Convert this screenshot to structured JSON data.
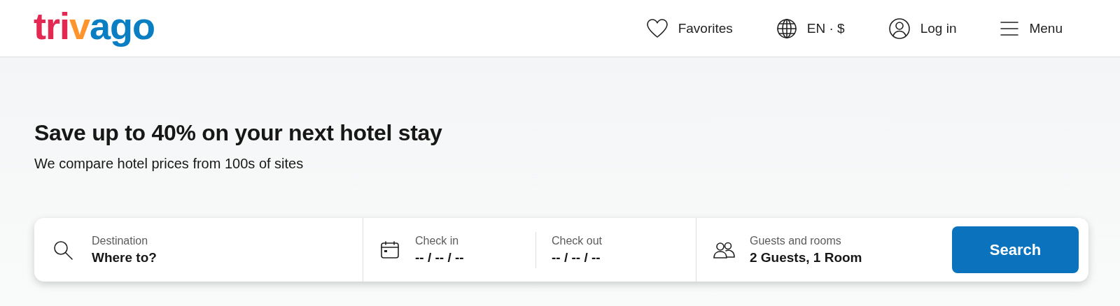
{
  "logo": {
    "parts": [
      {
        "text": "tri",
        "color": "#e32851"
      },
      {
        "text": "v",
        "color": "#ff932c"
      },
      {
        "text": "ago",
        "color": "#0a7ec2"
      }
    ]
  },
  "nav": [
    {
      "kind": "favorites",
      "label": "Favorites"
    },
    {
      "kind": "language",
      "label": "EN · $"
    },
    {
      "kind": "login",
      "label": "Log in"
    },
    {
      "kind": "menu",
      "label": "Menu"
    }
  ],
  "hero": {
    "title": "Save up to 40% on your next hotel stay",
    "subtitle": "We compare hotel prices from 100s of sites"
  },
  "search_bar": {
    "destination": {
      "label": "Destination",
      "placeholder": "Where to?"
    },
    "check_in": {
      "label": "Check in",
      "value": "-- / -- / --"
    },
    "check_out": {
      "label": "Check out",
      "value": "-- / -- / --"
    },
    "guests": {
      "label": "Guests and rooms",
      "value": "2 Guests, 1 Room"
    },
    "button": "Search"
  }
}
